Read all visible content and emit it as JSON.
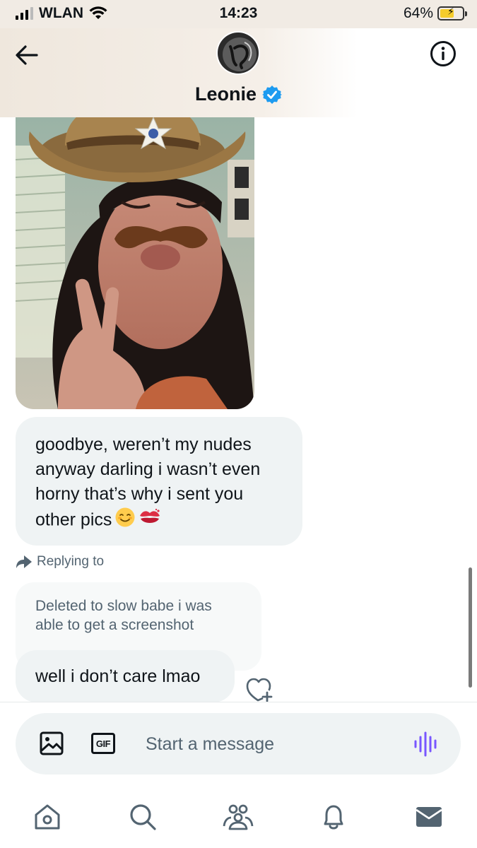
{
  "status_bar": {
    "carrier": "WLAN",
    "time": "14:23",
    "battery": "64%",
    "battery_level": 0.64
  },
  "header": {
    "contact_name": "Leonie",
    "verified": true
  },
  "messages": [
    {
      "type": "image",
      "alt": ""
    },
    {
      "type": "text",
      "text": "goodbye, weren’t my nudes anyway darling i wasn’t even horny that’s why i sent you other pics"
    },
    {
      "type": "reply",
      "reply_label": "Replying to",
      "quoted": "Deleted to slow babe i was able to get a screenshot",
      "text": "well i don’t care lmao"
    }
  ],
  "composer": {
    "placeholder": "Start a message",
    "gif_label": "GIF"
  },
  "nav": [
    "home",
    "search",
    "communities",
    "notifications",
    "messages"
  ],
  "colors": {
    "accent": "#1d9bf0",
    "voice": "#7856ff",
    "bubble": "#eff3f4",
    "muted": "#536471"
  },
  "icons": [
    "back-arrow-icon",
    "info-icon",
    "verified-badge-icon",
    "reply-arrow-icon",
    "heart-plus-icon",
    "image-icon",
    "gif-icon",
    "voice-icon",
    "home-icon",
    "search-icon",
    "communities-icon",
    "bell-icon",
    "mail-icon"
  ]
}
